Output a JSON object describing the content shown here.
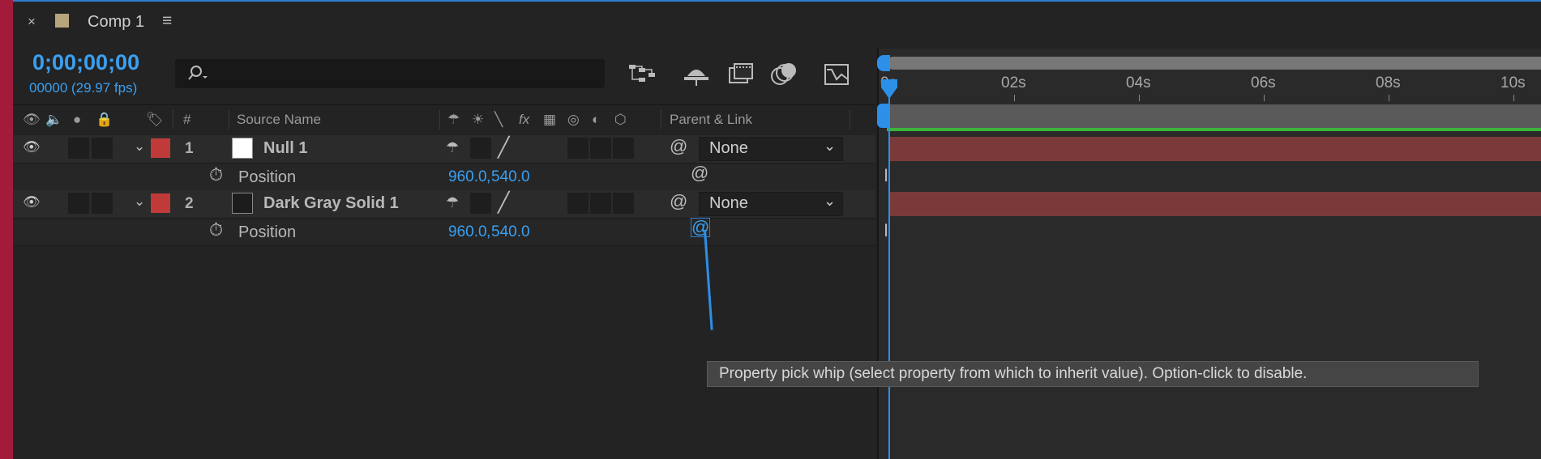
{
  "tab": {
    "title": "Comp 1",
    "close": "×",
    "menu": "≡"
  },
  "time": {
    "timecode": "0;00;00;00",
    "frames": "00000 (29.97 fps)"
  },
  "header": {
    "number": "#",
    "source_name": "Source Name",
    "parent_link": "Parent & Link",
    "fx": "fx"
  },
  "layers": [
    {
      "index": "1",
      "name": "Null 1",
      "swatch": "#ffffff",
      "label_color": "#c13a3a",
      "parent": "None",
      "property": {
        "name": "Position",
        "x": "960.0",
        "comma": ",",
        "y": "540.0"
      }
    },
    {
      "index": "2",
      "name": "Dark Gray Solid 1",
      "swatch": "#1c1c1c",
      "label_color": "#c13a3a",
      "parent": "None",
      "property": {
        "name": "Position",
        "x": "960.0",
        "comma": ",",
        "y": "540.0"
      }
    }
  ],
  "timeline": {
    "ruler": [
      "0s",
      "02s",
      "04s",
      "06s",
      "08s",
      "10s"
    ]
  },
  "tooltip": "Property pick whip (select property from which to inherit value). Option-click to disable.",
  "colors": {
    "accent": "#3aa0f2",
    "layer_bar": "#7a3a3a",
    "work_area": "#3cb43c"
  }
}
